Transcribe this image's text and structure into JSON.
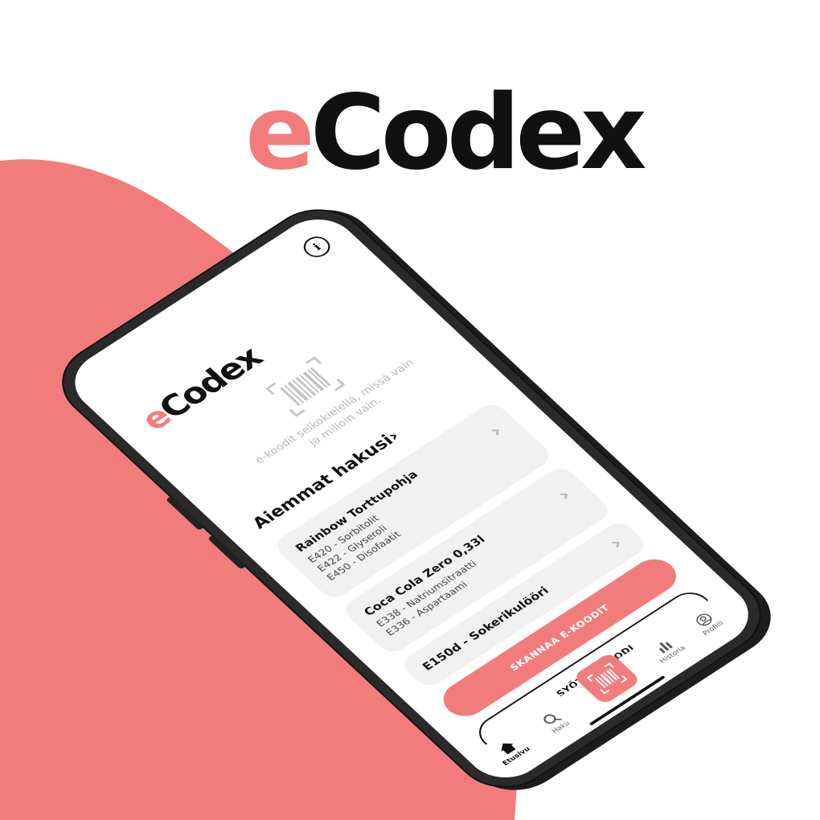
{
  "colors": {
    "brand": "#f27c7c",
    "ink": "#111111",
    "card": "#f1f1f1"
  },
  "hero": {
    "logo_prefix": "e",
    "logo_rest": "Codex"
  },
  "app": {
    "logo_prefix": "e",
    "logo_rest": "Codex",
    "info_label": "i",
    "scanner_icon": "barcode-scan-icon",
    "tagline_line1": "e-koodit selkokielellä, missä vain",
    "tagline_line2": "ja milloin vain."
  },
  "history": {
    "title": "Aiemmat hakusi",
    "arrow": "›",
    "items": [
      {
        "name": "Rainbow Torttupohja",
        "lines": [
          "E420 - Sorbitolit",
          "E422 - Glyseroli",
          "E450 - Disofaatit"
        ]
      },
      {
        "name": "Coca Cola Zero 0,33l",
        "lines": [
          "E338 - Natriumsitraatti",
          "E336 - Aspartaami"
        ]
      },
      {
        "name": "E150d - Sokerikulööri",
        "lines": []
      }
    ]
  },
  "actions": {
    "scan_label": "SKANNAA E-KOODIT",
    "enter_label": "SYÖTÄ E-KOODI"
  },
  "nav": {
    "home": "Etusivu",
    "search": "Haku",
    "history": "Historia",
    "profile": "Profiili"
  }
}
